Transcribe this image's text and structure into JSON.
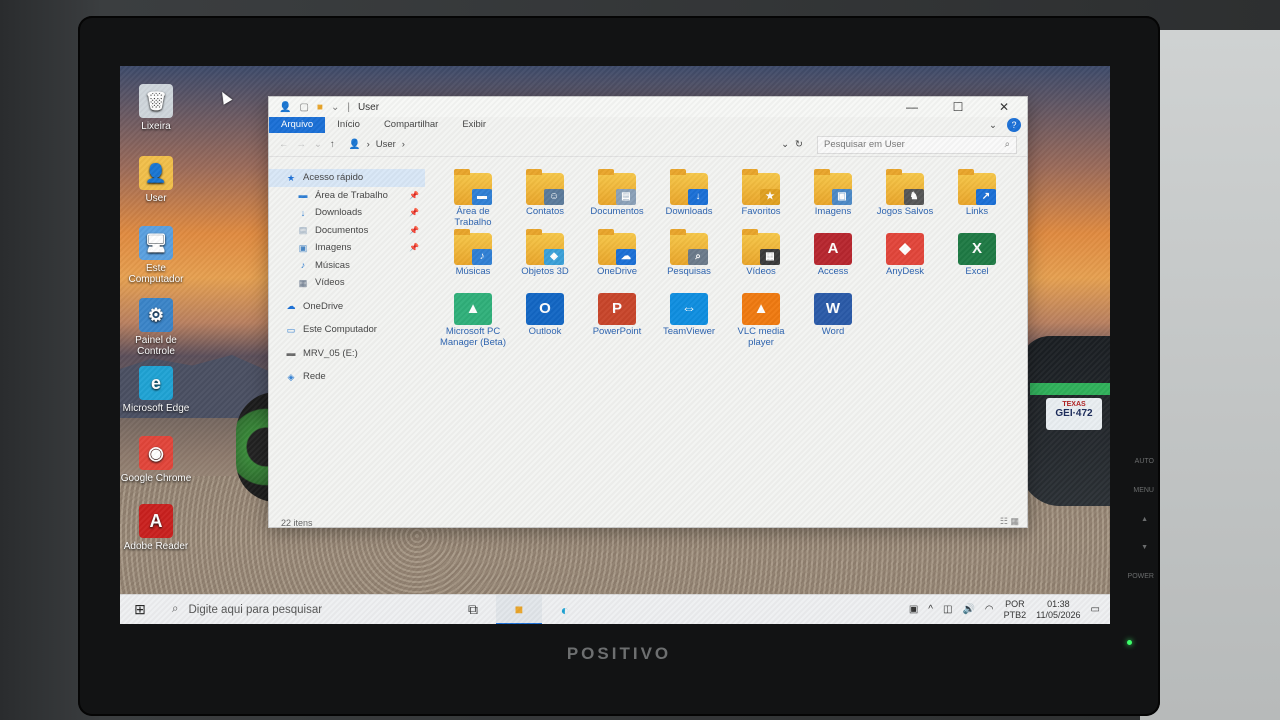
{
  "monitor": {
    "brand": "POSITIVO",
    "buttons": [
      "AUTO",
      "MENU",
      "▲",
      "▼",
      "POWER"
    ]
  },
  "desktop": {
    "icons": [
      {
        "label": "Lixeira",
        "icon": "recycle-bin-icon",
        "glyph": "🗑",
        "color": "#cfd6dc"
      },
      {
        "label": "User",
        "icon": "user-folder-icon",
        "glyph": "👤",
        "color": "#f1bf4a"
      },
      {
        "label": "Este Computador",
        "icon": "computer-icon",
        "glyph": "🖥",
        "color": "#5aa0e0"
      },
      {
        "label": "Painel de Controle",
        "icon": "control-panel-icon",
        "glyph": "⚙",
        "color": "#3a84c8"
      },
      {
        "label": "Microsoft Edge",
        "icon": "edge-icon",
        "glyph": "e",
        "color": "#1fa3d4"
      },
      {
        "label": "Google Chrome",
        "icon": "chrome-icon",
        "glyph": "◉",
        "color": "#e2453a"
      },
      {
        "label": "Adobe Reader",
        "icon": "adobe-reader-icon",
        "glyph": "A",
        "color": "#c9201e"
      }
    ]
  },
  "explorer": {
    "title": "User",
    "tabs": [
      "Arquivo",
      "Início",
      "Compartilhar",
      "Exibir"
    ],
    "active_tab": "Arquivo",
    "help": "?",
    "address": "User",
    "search_placeholder": "Pesquisar em User",
    "nav": [
      {
        "label": "Acesso rápido",
        "icon": "star-icon",
        "glyph": "★",
        "color": "#1a6fd6",
        "level": 0,
        "selected": true
      },
      {
        "label": "Área de Trabalho",
        "icon": "desktop-icon",
        "glyph": "▬",
        "color": "#2f7fd4",
        "level": 1,
        "pinned": true
      },
      {
        "label": "Downloads",
        "icon": "download-icon",
        "glyph": "↓",
        "color": "#2f7fd4",
        "level": 1,
        "pinned": true
      },
      {
        "label": "Documentos",
        "icon": "documents-icon",
        "glyph": "▤",
        "color": "#8aa0b8",
        "level": 1,
        "pinned": true
      },
      {
        "label": "Imagens",
        "icon": "images-icon",
        "glyph": "▣",
        "color": "#4a88c6",
        "level": 1,
        "pinned": true
      },
      {
        "label": "Músicas",
        "icon": "music-icon",
        "glyph": "♪",
        "color": "#2f7fd4",
        "level": 1
      },
      {
        "label": "Vídeos",
        "icon": "videos-icon",
        "glyph": "▦",
        "color": "#5a6a80",
        "level": 1
      },
      {
        "label": "OneDrive",
        "icon": "onedrive-icon",
        "glyph": "☁",
        "color": "#1a6fd6",
        "level": 0,
        "gap": true
      },
      {
        "label": "Este Computador",
        "icon": "computer-icon",
        "glyph": "▭",
        "color": "#2f7fd4",
        "level": 0,
        "gap": true
      },
      {
        "label": "MRV_05 (E:)",
        "icon": "drive-icon",
        "glyph": "▬",
        "color": "#6a6a6a",
        "level": 0,
        "gap": true
      },
      {
        "label": "Rede",
        "icon": "network-icon",
        "glyph": "◈",
        "color": "#2f7fd4",
        "level": 0,
        "gap": true
      }
    ],
    "items": [
      {
        "label": "Área de Trabalho",
        "kind": "folder",
        "icon": "desktop-folder-icon",
        "badge": "▬",
        "badge_color": "#2f7fd4"
      },
      {
        "label": "Contatos",
        "kind": "folder",
        "icon": "contacts-folder-icon",
        "badge": "☺",
        "badge_color": "#5a7a9a"
      },
      {
        "label": "Documentos",
        "kind": "folder",
        "icon": "documents-folder-icon",
        "badge": "▤",
        "badge_color": "#8aa0b8"
      },
      {
        "label": "Downloads",
        "kind": "folder",
        "icon": "downloads-folder-icon",
        "badge": "↓",
        "badge_color": "#1a6fd6"
      },
      {
        "label": "Favoritos",
        "kind": "folder",
        "icon": "favorites-folder-icon",
        "badge": "★",
        "badge_color": "#e0a020"
      },
      {
        "label": "Imagens",
        "kind": "folder",
        "icon": "images-folder-icon",
        "badge": "▣",
        "badge_color": "#4a88c6"
      },
      {
        "label": "Jogos Salvos",
        "kind": "folder",
        "icon": "saved-games-folder-icon",
        "badge": "♞",
        "badge_color": "#555555"
      },
      {
        "label": "Links",
        "kind": "folder",
        "icon": "links-folder-icon",
        "badge": "↗",
        "badge_color": "#1a6fd6"
      },
      {
        "label": "Músicas",
        "kind": "folder",
        "icon": "music-folder-icon",
        "badge": "♪",
        "badge_color": "#2f7fd4"
      },
      {
        "label": "Objetos 3D",
        "kind": "folder",
        "icon": "3d-objects-folder-icon",
        "badge": "◆",
        "badge_color": "#3aa0d8"
      },
      {
        "label": "OneDrive",
        "kind": "folder",
        "icon": "onedrive-folder-icon",
        "badge": "☁",
        "badge_color": "#1a6fd6"
      },
      {
        "label": "Pesquisas",
        "kind": "folder",
        "icon": "searches-folder-icon",
        "badge": "⌕",
        "badge_color": "#6a7a8a"
      },
      {
        "label": "Vídeos",
        "kind": "folder",
        "icon": "videos-folder-icon",
        "badge": "▦",
        "badge_color": "#3a3a3a"
      },
      {
        "label": "Access",
        "kind": "app",
        "icon": "access-icon",
        "glyph": "A",
        "color": "#b7262e"
      },
      {
        "label": "AnyDesk",
        "kind": "app",
        "icon": "anydesk-icon",
        "glyph": "◆",
        "color": "#e2453a"
      },
      {
        "label": "Excel",
        "kind": "app",
        "icon": "excel-icon",
        "glyph": "X",
        "color": "#1e7a44"
      },
      {
        "label": "Microsoft PC Manager (Beta)",
        "kind": "app",
        "icon": "pc-manager-icon",
        "glyph": "▲",
        "color": "#2fb07a"
      },
      {
        "label": "Outlook",
        "kind": "app",
        "icon": "outlook-icon",
        "glyph": "O",
        "color": "#1266c4"
      },
      {
        "label": "PowerPoint",
        "kind": "app",
        "icon": "powerpoint-icon",
        "glyph": "P",
        "color": "#c8452a"
      },
      {
        "label": "TeamViewer",
        "kind": "app",
        "icon": "teamviewer-icon",
        "glyph": "⇔",
        "color": "#0e8ee0"
      },
      {
        "label": "VLC media player",
        "kind": "app",
        "icon": "vlc-icon",
        "glyph": "▲",
        "color": "#f07a10"
      },
      {
        "label": "Word",
        "kind": "app",
        "icon": "word-icon",
        "glyph": "W",
        "color": "#2a5aa8"
      }
    ],
    "status": "22 itens"
  },
  "taskbar": {
    "search_placeholder": "Digite aqui para pesquisar",
    "lang_top": "POR",
    "lang_bottom": "PTB2",
    "time": "01:38",
    "date": "11/05/2026"
  },
  "wallpaper": {
    "plate_top": "TEXAS",
    "plate": "GEI·472"
  }
}
